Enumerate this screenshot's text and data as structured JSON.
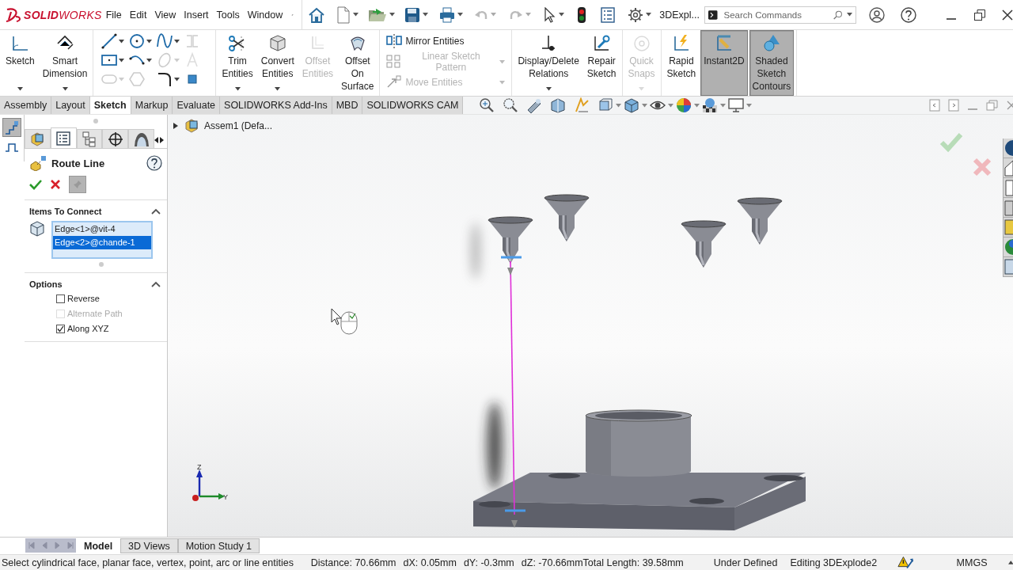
{
  "title_bar": {
    "logo": "**SOLID**WORKS",
    "menus": [
      "File",
      "Edit",
      "View",
      "Insert",
      "Tools",
      "Window"
    ],
    "document": "3DExpl...",
    "search": {
      "placeholder": "Search Commands"
    }
  },
  "ribbon": {
    "groups": [
      {
        "kind": "large",
        "buttons": [
          {
            "label": "Sketch",
            "dropdown": true,
            "disabled": false,
            "pressed": false
          },
          {
            "label": "Smart Dimension",
            "dropdown": true,
            "disabled": false,
            "pressed": false
          }
        ]
      },
      {
        "kind": "tools"
      },
      {
        "kind": "large",
        "buttons": [
          {
            "label": "Trim Entities",
            "dropdown": true,
            "disabled": false,
            "pressed": false
          },
          {
            "label": "Convert Entities",
            "dropdown": true,
            "disabled": false,
            "pressed": false
          },
          {
            "label": "Offset Entities",
            "dropdown": false,
            "disabled": true,
            "pressed": false
          },
          {
            "label": "Offset On Surface",
            "dropdown": false,
            "disabled": false,
            "pressed": false
          }
        ]
      },
      {
        "kind": "list",
        "buttons": [
          {
            "label": "Mirror Entities",
            "dropdown": false,
            "disabled": false
          },
          {
            "label": "Linear Sketch Pattern",
            "dropdown": true,
            "disabled": true
          },
          {
            "label": "Move Entities",
            "dropdown": true,
            "disabled": true
          }
        ]
      },
      {
        "kind": "large",
        "buttons": [
          {
            "label": "Display/Delete Relations",
            "dropdown": true,
            "disabled": false,
            "pressed": false
          },
          {
            "label": "Repair Sketch",
            "dropdown": false,
            "disabled": false,
            "pressed": false
          }
        ]
      },
      {
        "kind": "large",
        "buttons": [
          {
            "label": "Quick Snaps",
            "dropdown": true,
            "disabled": true,
            "pressed": false
          }
        ]
      },
      {
        "kind": "large",
        "buttons": [
          {
            "label": "Rapid Sketch",
            "dropdown": false,
            "disabled": false,
            "pressed": false
          },
          {
            "label": "Instant2D",
            "dropdown": false,
            "disabled": false,
            "pressed": true
          },
          {
            "label": "Shaded Sketch Contours",
            "dropdown": false,
            "disabled": false,
            "pressed": true
          }
        ]
      }
    ]
  },
  "command_tabs": [
    {
      "label": "Assembly",
      "selected": false
    },
    {
      "label": "Layout",
      "selected": false
    },
    {
      "label": "Sketch",
      "selected": true
    },
    {
      "label": "Markup",
      "selected": false
    },
    {
      "label": "Evaluate",
      "selected": false
    },
    {
      "label": "SOLIDWORKS Add-Ins",
      "selected": false
    },
    {
      "label": "MBD",
      "selected": false
    },
    {
      "label": "SOLIDWORKS CAM",
      "selected": false
    }
  ],
  "panel_tabs": [
    {
      "kind": "feature",
      "selected": false
    },
    {
      "kind": "property",
      "selected": true
    },
    {
      "kind": "configuration",
      "selected": false
    },
    {
      "kind": "dimxpert",
      "selected": false
    },
    {
      "kind": "display",
      "selected": false
    }
  ],
  "property_manager": {
    "title": "Route Line",
    "sections": [
      {
        "kind": "selection",
        "title": "Items To Connect",
        "expanded": true,
        "items": [
          {
            "label": "Edge<1>@vit-4",
            "selected": false
          },
          {
            "label": "Edge<2>@chande-1",
            "selected": true
          }
        ]
      },
      {
        "kind": "options",
        "title": "Options",
        "expanded": true,
        "options": [
          {
            "label": "Reverse",
            "checked": false,
            "disabled": false
          },
          {
            "label": "Alternate Path",
            "checked": false,
            "disabled": true
          },
          {
            "label": "Along XYZ",
            "checked": true,
            "disabled": false
          }
        ]
      }
    ]
  },
  "feature_tree": {
    "root": "Assem1 (Defa...",
    "expanded": false
  },
  "triad": {
    "axes": [
      "Z",
      "Y"
    ]
  },
  "bottom_tabs": [
    {
      "label": "Model",
      "selected": true
    },
    {
      "label": "3D Views",
      "selected": false
    },
    {
      "label": "Motion Study 1",
      "selected": false
    }
  ],
  "status_bar": {
    "message": "Select cylindrical face, planar face, vertex, point, arc or line entities",
    "distance": "Distance: 70.66mm",
    "dx": "dX: 0.05mm",
    "dy": "dY: -0.3mm",
    "dz": "dZ: -70.66mm",
    "total": "Total Length: 39.58mm",
    "sketch_state": "Under Defined",
    "editing": "Editing 3DExplode2",
    "units": "MMGS"
  }
}
